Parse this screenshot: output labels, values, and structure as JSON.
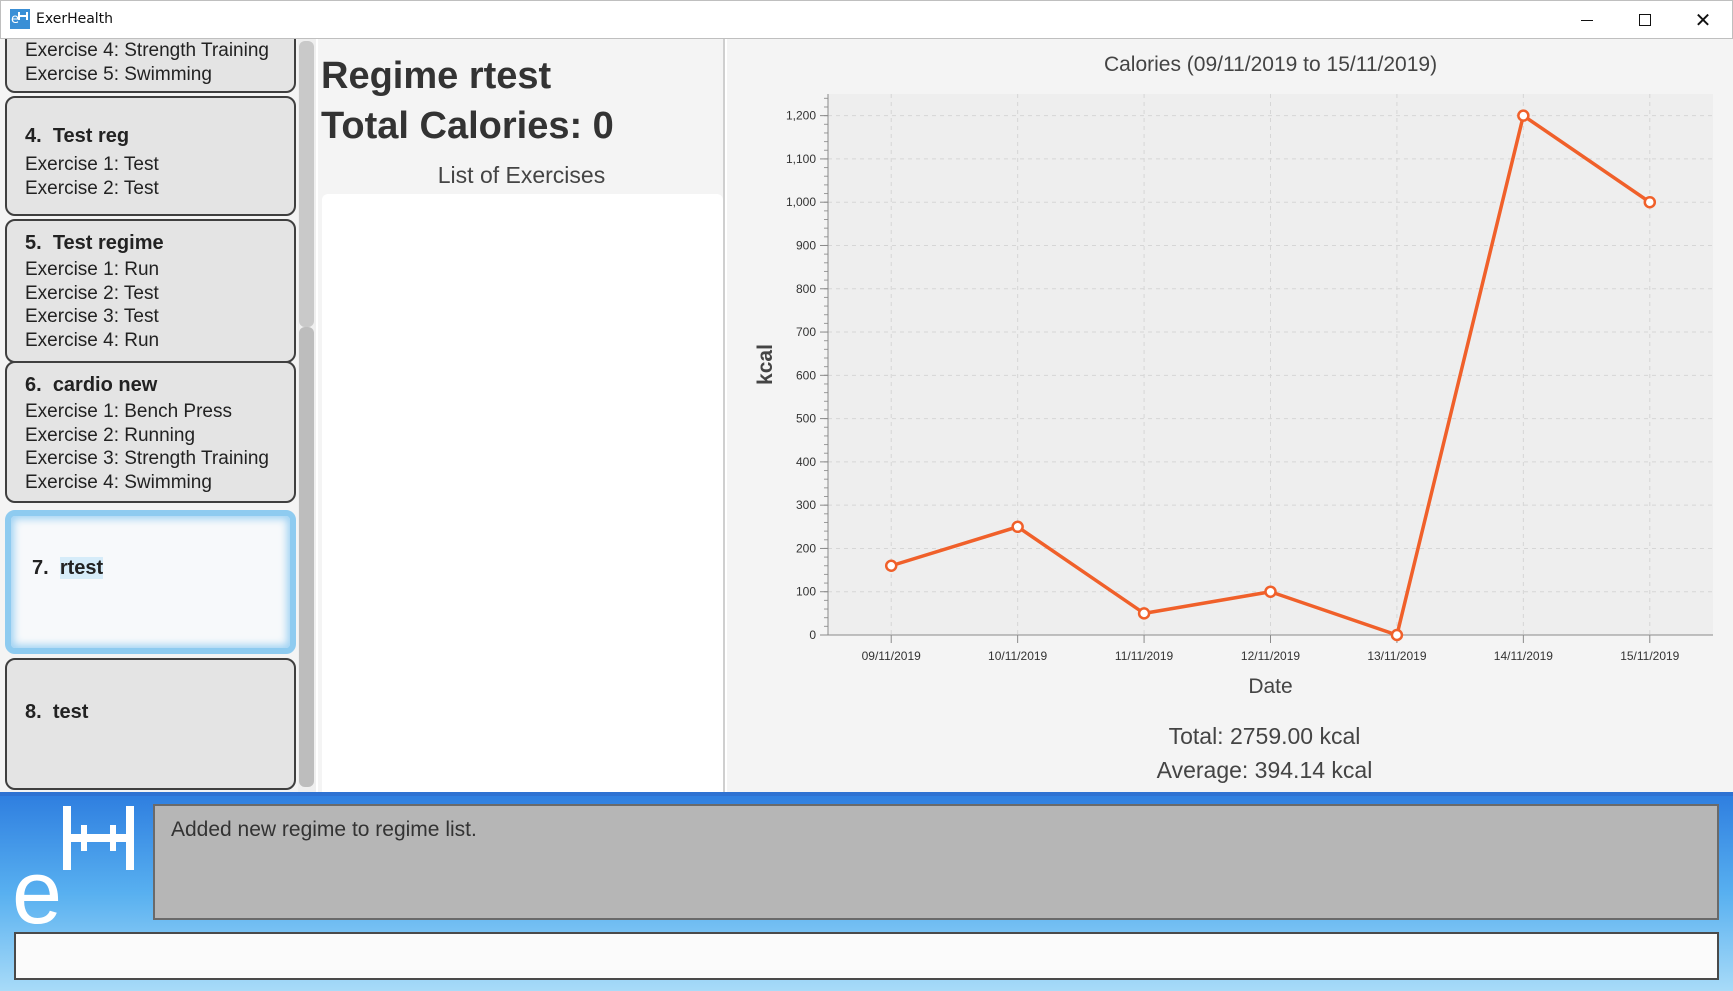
{
  "window": {
    "title": "ExerHealth",
    "icon": "exerhealth-app-icon",
    "controls": {
      "minimize": "minimize-icon",
      "maximize": "maximize-icon",
      "close_glyph": "✕"
    }
  },
  "regime_list": {
    "partial_card": {
      "exercises": [
        "Exercise 4: Strength Training",
        "Exercise 5: Swimming"
      ]
    },
    "cards": [
      {
        "index": "4.",
        "name": "Test reg",
        "exercises": [
          "Exercise 1: Test",
          "Exercise 2: Test"
        ]
      },
      {
        "index": "5.",
        "name": "Test regime",
        "exercises": [
          "Exercise 1: Run",
          "Exercise 2: Test",
          "Exercise 3: Test",
          "Exercise 4: Run"
        ]
      },
      {
        "index": "6.",
        "name": "cardio new",
        "exercises": [
          "Exercise 1: Bench Press",
          "Exercise 2: Running",
          "Exercise 3: Strength Training",
          "Exercise 4: Swimming"
        ]
      },
      {
        "index": "7.",
        "name": "rtest",
        "exercises": [],
        "selected": true
      },
      {
        "index": "8.",
        "name": "test",
        "exercises": []
      }
    ]
  },
  "regime_detail": {
    "title": "Regime rtest",
    "total_calories": "Total Calories: 0",
    "list_label": "List of Exercises"
  },
  "chart_data": {
    "type": "line",
    "title": "Calories (09/11/2019 to 15/11/2019)",
    "xlabel": "Date",
    "ylabel": "kcal",
    "categories": [
      "09/11/2019",
      "10/11/2019",
      "11/11/2019",
      "12/11/2019",
      "13/11/2019",
      "14/11/2019",
      "15/11/2019"
    ],
    "series": [
      {
        "values": [
          160,
          250,
          50,
          100,
          0,
          1200,
          1000
        ],
        "color": "#f0602a"
      }
    ],
    "ylim": [
      0,
      1250
    ],
    "yticks": [
      0,
      100,
      200,
      300,
      400,
      500,
      600,
      700,
      800,
      900,
      1000,
      1100,
      1200
    ],
    "ytick_labels": [
      "0",
      "100",
      "200",
      "300",
      "400",
      "500",
      "600",
      "700",
      "800",
      "900",
      "1,000",
      "1,100",
      "1,200"
    ],
    "grid": true
  },
  "stats": {
    "total": "Total: 2759.00 kcal",
    "average": "Average: 394.14 kcal"
  },
  "result_display": {
    "message": "Added new regime to regime list."
  },
  "command_box": {
    "value": "",
    "placeholder": ""
  },
  "colors": {
    "accent_blue": "#2f7fe0",
    "line": "#f0602a",
    "selected_border": "#8ecbf0"
  }
}
